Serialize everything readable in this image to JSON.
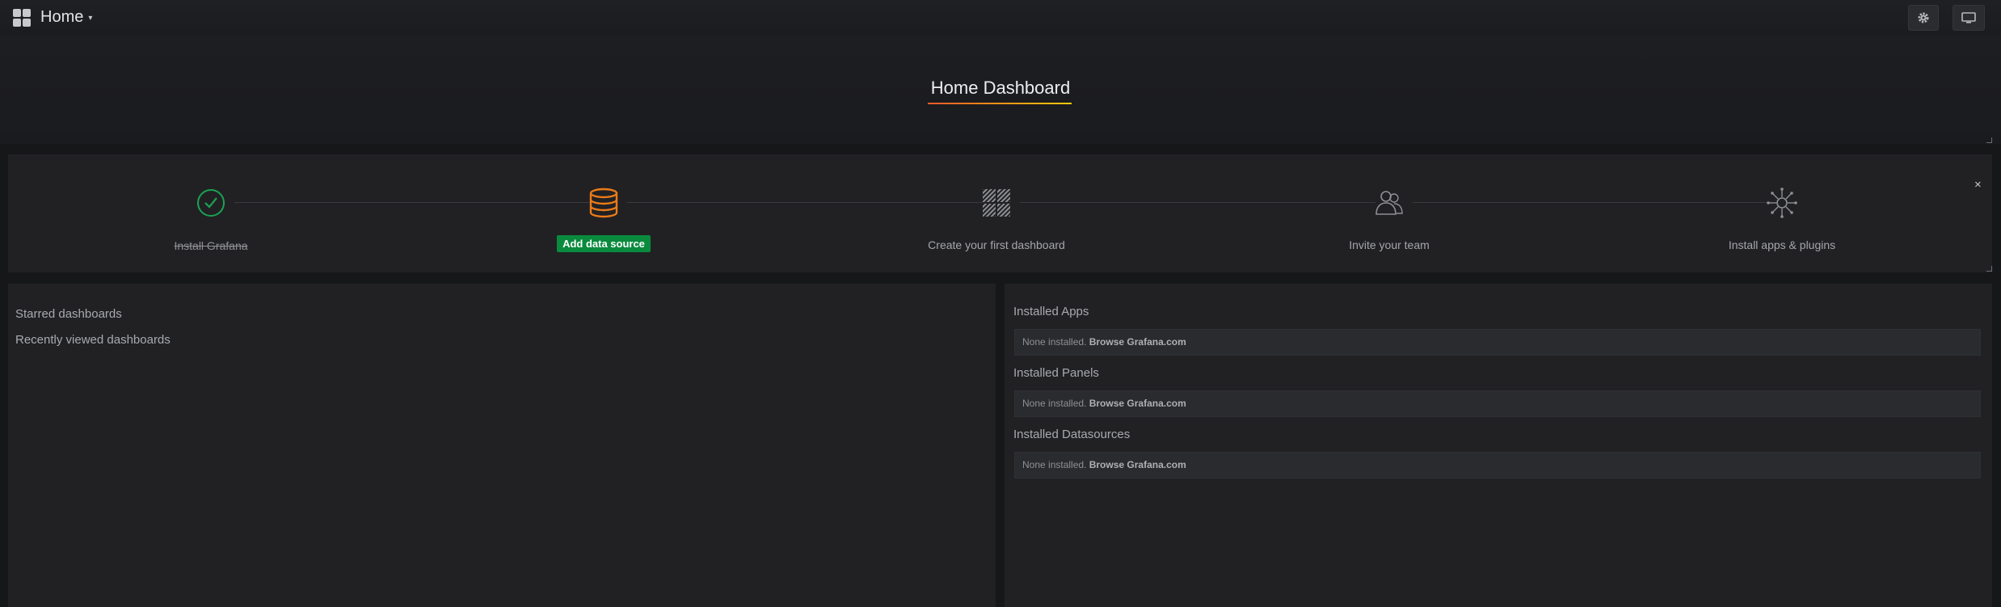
{
  "topbar": {
    "title": "Home",
    "icons": {
      "app": "grid-icon",
      "caret": "caret-down-icon",
      "settings": "gear-icon",
      "tv": "tv-monitor-icon"
    }
  },
  "header": {
    "dashboard_title": "Home Dashboard"
  },
  "steps": [
    {
      "label": "Install Grafana",
      "status": "done",
      "icon": "checkmark-circle-icon"
    },
    {
      "label": "Add data source",
      "status": "active",
      "icon": "database-icon"
    },
    {
      "label": "Create your first dashboard",
      "status": "pending",
      "icon": "dashboard-grid-icon"
    },
    {
      "label": "Invite your team",
      "status": "pending",
      "icon": "users-icon"
    },
    {
      "label": "Install apps & plugins",
      "status": "pending",
      "icon": "plugins-icon"
    }
  ],
  "close_label": "×",
  "left_panel": {
    "starred": "Starred dashboards",
    "recent": "Recently viewed dashboards"
  },
  "right_panel": {
    "sections": [
      {
        "heading": "Installed Apps",
        "none_text": "None installed.",
        "link": "Browse Grafana.com"
      },
      {
        "heading": "Installed Panels",
        "none_text": "None installed.",
        "link": "Browse Grafana.com"
      },
      {
        "heading": "Installed Datasources",
        "none_text": "None installed.",
        "link": "Browse Grafana.com"
      }
    ]
  },
  "colors": {
    "success": "#0a8a3d",
    "accent_orange": "#eb7b18",
    "background": "#161719",
    "panel": "#212124"
  }
}
